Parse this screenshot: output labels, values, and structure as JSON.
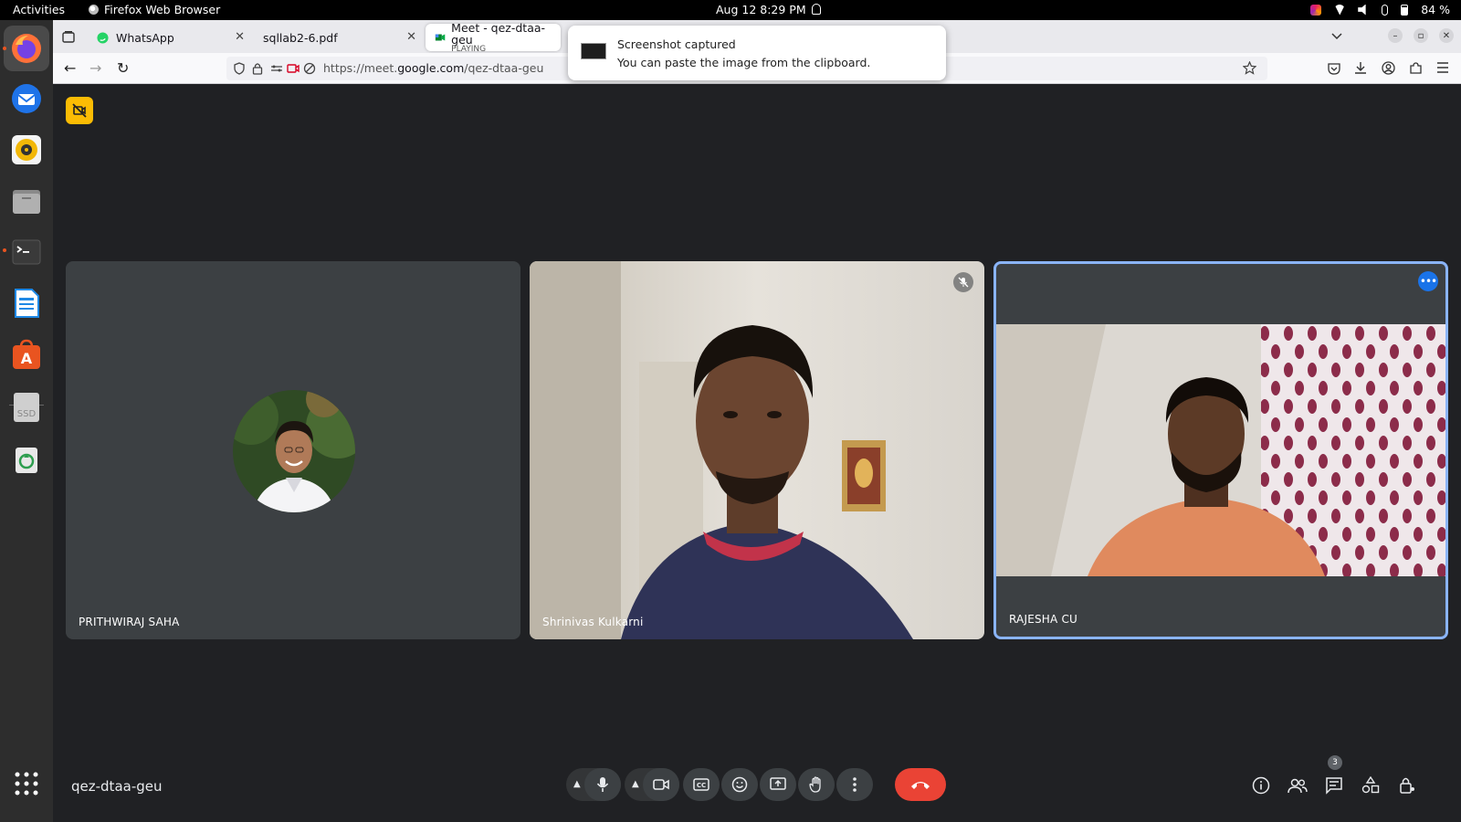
{
  "system_bar": {
    "activities": "Activities",
    "app_name": "Firefox Web Browser",
    "clock": "Aug 12  8:29 PM",
    "battery": "84 %"
  },
  "browser": {
    "tabs": [
      {
        "label": "WhatsApp"
      },
      {
        "label": "sqllab2-6.pdf"
      },
      {
        "label": "Meet - qez-dtaa-geu",
        "status": "PLAYING"
      }
    ],
    "url_prefix": "https://meet.",
    "url_domain": "google.com",
    "url_path": "/qez-dtaa-geu"
  },
  "notification": {
    "title": "Screenshot captured",
    "body": "You can paste the image from the clipboard."
  },
  "meet": {
    "meeting_code": "qez-dtaa-geu",
    "participants_count": "3",
    "participants": [
      {
        "name": "PRITHWIRAJ SAHA"
      },
      {
        "name": "Shrinivas Kulkarni"
      },
      {
        "name": "RAJESHA CU"
      }
    ]
  },
  "colors": {
    "stage_bg": "#202124",
    "tile_bg": "#3c4043",
    "active_outline": "#8ab4f8",
    "end_call": "#ea4335",
    "badge": "#fbbc04"
  }
}
